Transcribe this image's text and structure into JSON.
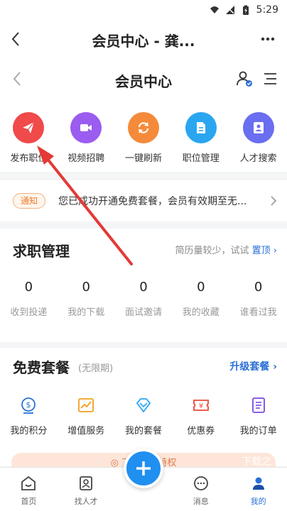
{
  "status_bar": {
    "time": "5:29"
  },
  "top_nav": {
    "title": "会员中心 - 龚..."
  },
  "header": {
    "title": "会员中心"
  },
  "quick_actions": [
    {
      "label": "发布职位",
      "icon": "paper-plane-icon",
      "color": "#f04a4a"
    },
    {
      "label": "视频招聘",
      "icon": "video-icon",
      "color": "#9b5cf0"
    },
    {
      "label": "一键刷新",
      "icon": "refresh-icon",
      "color": "#f58a3a"
    },
    {
      "label": "职位管理",
      "icon": "document-icon",
      "color": "#2aa6f0"
    },
    {
      "label": "人才搜索",
      "icon": "person-search-icon",
      "color": "#6a6ef0"
    }
  ],
  "notice": {
    "tag": "通知",
    "message": "您已成功开通免费套餐，会员有效期至无..."
  },
  "job_management": {
    "title": "求职管理",
    "hint_text": "简历量较少，试试",
    "hint_link": "置顶",
    "stats": [
      {
        "value": "0",
        "label": "收到投递"
      },
      {
        "value": "0",
        "label": "我的下载"
      },
      {
        "value": "0",
        "label": "面试邀请"
      },
      {
        "value": "0",
        "label": "我的收藏"
      },
      {
        "value": "0",
        "label": "谁看过我"
      }
    ]
  },
  "free_package": {
    "title": "免费套餐",
    "subtitle": "(无限期)",
    "upgrade_label": "升级套餐",
    "services": [
      {
        "label": "我的积分",
        "icon": "points-icon"
      },
      {
        "label": "增值服务",
        "icon": "chart-icon"
      },
      {
        "label": "我的套餐",
        "icon": "diamond-icon"
      },
      {
        "label": "优惠券",
        "icon": "coupon-icon"
      },
      {
        "label": "我的订单",
        "icon": "order-icon"
      }
    ],
    "banner_text": "◎ 了解...聘特权"
  },
  "tab_bar": [
    {
      "label": "首页",
      "icon": "home-icon"
    },
    {
      "label": "找人才",
      "icon": "contacts-icon"
    },
    {
      "label": "",
      "icon": "plus-icon"
    },
    {
      "label": "消息",
      "icon": "message-icon"
    },
    {
      "label": "我的",
      "icon": "profile-icon"
    }
  ],
  "watermark": "下载之",
  "colors": {
    "accent": "#2a70d6",
    "fab": "#1f8ff0",
    "annotation_arrow": "#e53935"
  }
}
